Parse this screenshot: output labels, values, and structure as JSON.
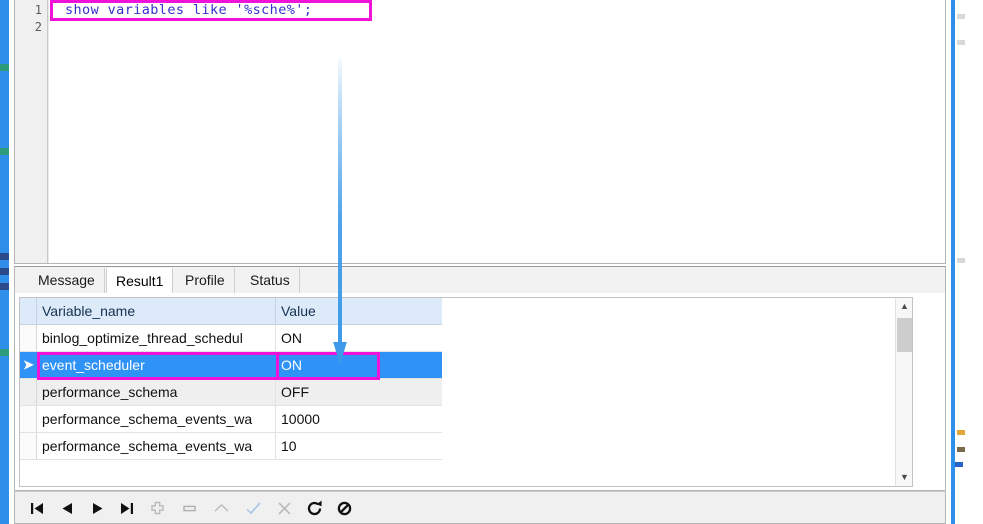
{
  "editor": {
    "lines": [
      {
        "number": "1",
        "text": "show variables like '%sche%';"
      },
      {
        "number": "2",
        "text": ""
      }
    ],
    "highlight_color": "#f012d8"
  },
  "annotation": {
    "arrow_color": "#3d9ae8",
    "name": "blue-down-arrow"
  },
  "tabs": [
    {
      "label": "Message",
      "active": false
    },
    {
      "label": "Result1",
      "active": true
    },
    {
      "label": "Profile",
      "active": false
    },
    {
      "label": "Status",
      "active": false
    }
  ],
  "grid": {
    "columns": [
      "Variable_name",
      "Value"
    ],
    "rows": [
      {
        "name": "binlog_optimize_thread_schedul",
        "value": "ON",
        "selected": false
      },
      {
        "name": "event_scheduler",
        "value": "ON",
        "selected": true
      },
      {
        "name": "performance_schema",
        "value": "OFF",
        "selected": false
      },
      {
        "name": "performance_schema_events_wa",
        "value": "10000",
        "selected": false
      },
      {
        "name": "performance_schema_events_wa",
        "value": "10",
        "selected": false
      }
    ],
    "selection_color": "#2f92f7",
    "header_color": "#dceafa"
  },
  "toolbar": {
    "buttons": [
      {
        "name": "first-record-button",
        "icon": "first-record-icon",
        "enabled": true
      },
      {
        "name": "previous-record-button",
        "icon": "previous-record-icon",
        "enabled": true
      },
      {
        "name": "next-record-button",
        "icon": "next-record-icon",
        "enabled": true
      },
      {
        "name": "last-record-button",
        "icon": "last-record-icon",
        "enabled": true
      },
      {
        "name": "add-record-button",
        "icon": "plus-icon",
        "enabled": false
      },
      {
        "name": "delete-record-button",
        "icon": "minus-icon",
        "enabled": false
      },
      {
        "name": "edit-record-button",
        "icon": "caret-up-icon",
        "enabled": false
      },
      {
        "name": "apply-change-button",
        "icon": "check-icon",
        "enabled": false
      },
      {
        "name": "cancel-change-button",
        "icon": "cross-icon",
        "enabled": false
      },
      {
        "name": "refresh-button",
        "icon": "refresh-icon",
        "enabled": true
      },
      {
        "name": "stop-button",
        "icon": "stop-icon",
        "enabled": true
      }
    ]
  }
}
